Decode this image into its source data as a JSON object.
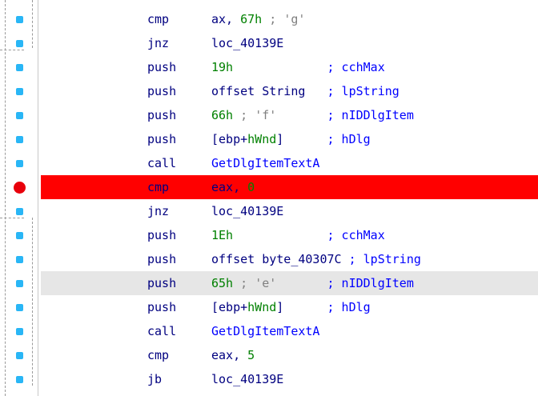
{
  "colors": {
    "mnemonic": "#000080",
    "number": "#008000",
    "comment_gray": "#808080",
    "comment_blue": "#0000ff",
    "breakpoint_bg": "#ff0000",
    "selected_bg": "#e6e6e6",
    "bp_dot": "#29b6f6"
  },
  "gutter": {
    "markers": [
      {
        "icon": "breakpoint-slot-icon"
      },
      {
        "icon": "breakpoint-slot-icon"
      },
      {
        "icon": "breakpoint-slot-icon"
      },
      {
        "icon": "breakpoint-slot-icon"
      },
      {
        "icon": "breakpoint-slot-icon"
      },
      {
        "icon": "breakpoint-slot-icon"
      },
      {
        "icon": "breakpoint-slot-icon"
      },
      {
        "icon": "breakpoint-active-icon"
      },
      {
        "icon": "breakpoint-slot-icon"
      },
      {
        "icon": "breakpoint-slot-icon"
      },
      {
        "icon": "breakpoint-slot-icon"
      },
      {
        "icon": "breakpoint-slot-icon"
      },
      {
        "icon": "breakpoint-slot-icon"
      },
      {
        "icon": "breakpoint-slot-icon"
      },
      {
        "icon": "breakpoint-slot-icon"
      },
      {
        "icon": "breakpoint-slot-icon"
      }
    ]
  },
  "listing": {
    "lines": [
      {
        "mnemonic": "cmp",
        "operands": [
          {
            "t": "ax, "
          },
          {
            "t": "67h",
            "c": "num"
          },
          {
            "t": " ; ",
            "c": "cmt"
          },
          {
            "t": "'g'",
            "c": "cmt"
          }
        ]
      },
      {
        "mnemonic": "jnz",
        "operands": [
          {
            "t": "loc_40139E"
          }
        ]
      },
      {
        "mnemonic": "push",
        "operands": [
          {
            "t": "19h",
            "c": "num"
          },
          {
            "t": "             ; cchMax",
            "c": "tag"
          }
        ]
      },
      {
        "mnemonic": "push",
        "operands": [
          {
            "t": "offset String   "
          },
          {
            "t": "; lpString",
            "c": "tag"
          }
        ]
      },
      {
        "mnemonic": "push",
        "operands": [
          {
            "t": "66h",
            "c": "num"
          },
          {
            "t": " ; ",
            "c": "cmt"
          },
          {
            "t": "'f'",
            "c": "cmt"
          },
          {
            "t": "       ; nIDDlgItem",
            "c": "tag"
          }
        ]
      },
      {
        "mnemonic": "push",
        "operands": [
          {
            "t": "[ebp+"
          },
          {
            "t": "hWnd",
            "c": "num"
          },
          {
            "t": "]      "
          },
          {
            "t": "; hDlg",
            "c": "tag"
          }
        ]
      },
      {
        "mnemonic": "call",
        "operands": [
          {
            "t": "GetDlgItemTextA",
            "c": "tag"
          }
        ]
      },
      {
        "mnemonic": "cmp",
        "operands": [
          {
            "t": "eax, "
          },
          {
            "t": "0",
            "c": "num"
          }
        ],
        "state": "breakpoint"
      },
      {
        "mnemonic": "jnz",
        "operands": [
          {
            "t": "loc_40139E"
          }
        ]
      },
      {
        "mnemonic": "push",
        "operands": [
          {
            "t": "1Eh",
            "c": "num"
          },
          {
            "t": "             ; cchMax",
            "c": "tag"
          }
        ]
      },
      {
        "mnemonic": "push",
        "operands": [
          {
            "t": "offset byte_40307C "
          },
          {
            "t": "; lpString",
            "c": "tag"
          }
        ]
      },
      {
        "mnemonic": "push",
        "operands": [
          {
            "t": "65h",
            "c": "num"
          },
          {
            "t": " ; ",
            "c": "cmt"
          },
          {
            "t": "'e'",
            "c": "cmt"
          },
          {
            "t": "       ; nIDDlgItem",
            "c": "tag"
          }
        ],
        "state": "selected"
      },
      {
        "mnemonic": "push",
        "operands": [
          {
            "t": "[ebp+"
          },
          {
            "t": "hWnd",
            "c": "num"
          },
          {
            "t": "]      "
          },
          {
            "t": "; hDlg",
            "c": "tag"
          }
        ]
      },
      {
        "mnemonic": "call",
        "operands": [
          {
            "t": "GetDlgItemTextA",
            "c": "tag"
          }
        ]
      },
      {
        "mnemonic": "cmp",
        "operands": [
          {
            "t": "eax, "
          },
          {
            "t": "5",
            "c": "num"
          }
        ]
      },
      {
        "mnemonic": "jb",
        "operands": [
          {
            "t": "loc_40139E"
          }
        ]
      }
    ]
  }
}
